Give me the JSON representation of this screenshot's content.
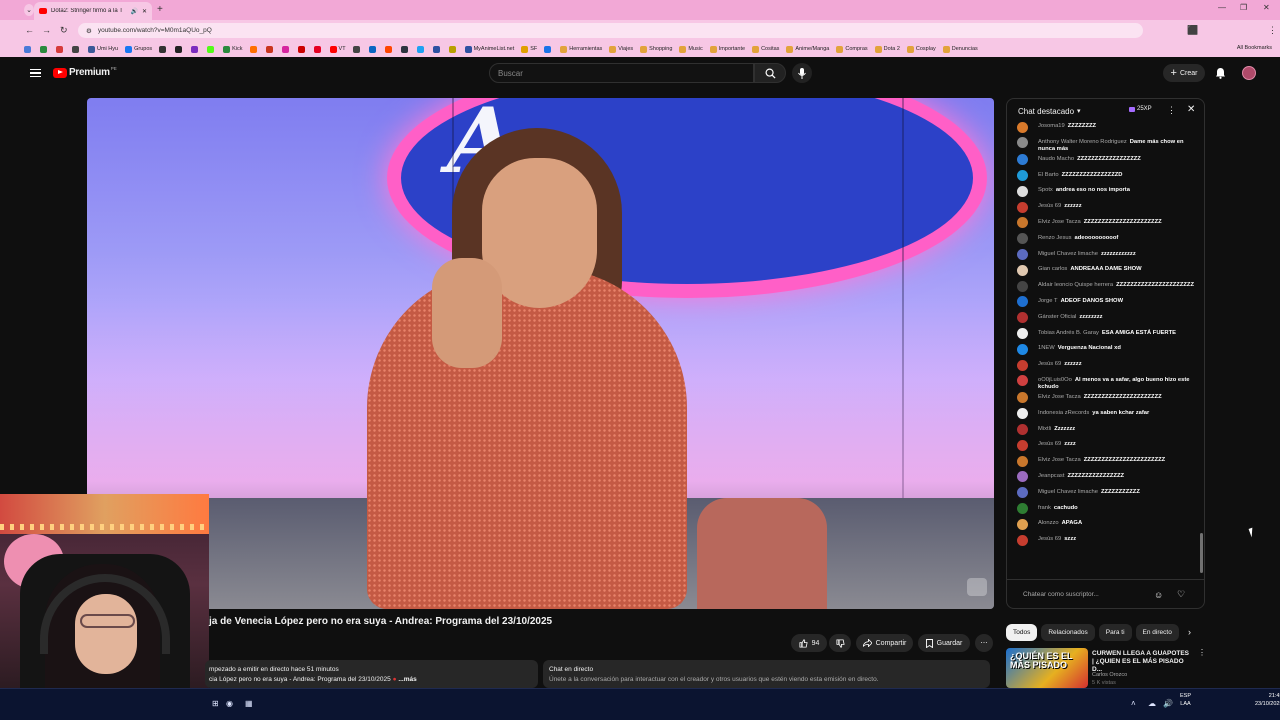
{
  "browser": {
    "tab_title": "Dota2: Stringer firmó a la T",
    "url": "youtube.com/watch?v=M0m1aQUo_pQ",
    "bookmarks": [
      "",
      "",
      "",
      "",
      "Umi Hyu",
      "Grupos",
      "",
      "",
      "",
      "",
      "Kick",
      "",
      "",
      "",
      "",
      "",
      "VT",
      "",
      "",
      "",
      "",
      "",
      "",
      "",
      "MyAnimeList.net",
      "SF",
      "",
      "Herramientas",
      "Viajes",
      "Shopping",
      "Music",
      "Importante",
      "Cositas",
      "Anime/Manga",
      "Compras",
      "Dota 2",
      "Cosplay",
      "Denuncias"
    ],
    "all_bookmarks": "All Bookmarks"
  },
  "youtube": {
    "logo_text": "Premium",
    "region": "PE",
    "search_placeholder": "Buscar",
    "create_label": "Crear"
  },
  "video": {
    "title": "ja de Venecia López pero no era suya - Andrea: Programa del 23/10/2025",
    "like_count": "94",
    "share_label": "Compartir",
    "save_label": "Guardar",
    "desc_line1": "mpezado a emitir en directo hace 51 minutos",
    "desc_line2": "cia López pero no era suya - Andrea: Programa del 23/10/2025",
    "desc_more": "...más",
    "livechat_title": "Chat en directo",
    "livechat_text": "Únete a la conversación para interactuar con el creador y otros usuarios que estén viendo esta emisión en directo."
  },
  "chat": {
    "header": "Chat destacado",
    "xp": "25XP",
    "input_placeholder": "Chatear como suscriptor...",
    "messages": [
      {
        "name": "Josoma19",
        "text": "ZZZZZZZZ",
        "color": "#d97a2b"
      },
      {
        "name": "Anthony Walter Moreno Rodriguez",
        "text": "Dame más chow en nunca más",
        "color": "#8a8a8a"
      },
      {
        "name": "Naudo Macho",
        "text": "ZZZZZZZZZZZZZZZZZZ",
        "color": "#2d7bd4"
      },
      {
        "name": "El Barto",
        "text": "ZZZZZZZZZZZZZZZZD",
        "color": "#1f9bd8"
      },
      {
        "name": "Spotx",
        "text": "andrea eso no nos importa",
        "color": "#dddddd"
      },
      {
        "name": "Jesús 69",
        "text": "zzzzzz",
        "color": "#c63d2f"
      },
      {
        "name": "Elviz Jose Tacza",
        "text": "ZZZZZZZZZZZZZZZZZZZZZZ",
        "color": "#c9772c"
      },
      {
        "name": "Renzo Jesus",
        "text": "adeooooooooof",
        "color": "#555555"
      },
      {
        "name": "Miguel Chavez limache",
        "text": "zzzzzzzzzzzz",
        "color": "#5c6bc0"
      },
      {
        "name": "Gian carlos",
        "text": "ANDREAAA DAME SHOW",
        "color": "#e0c8b0"
      },
      {
        "name": "Aldair leoncio Quispe herrera",
        "text": "ZZZZZZZZZZZZZZZZZZZZZZ",
        "color": "#444444"
      },
      {
        "name": "Jorge T",
        "text": "ADEOF DANOS SHOW",
        "color": "#1e6fd0"
      },
      {
        "name": "Gánster Oficial",
        "text": "zzzzzzzz",
        "color": "#b03030"
      },
      {
        "name": "Tobias Andrés B. Garay",
        "text": "ESA AMIGA ESTÁ FUERTE",
        "color": "#eeeeee"
      },
      {
        "name": "1NEW",
        "text": "Verguenza Nacional xd",
        "color": "#1e88e5"
      },
      {
        "name": "Jesús 69",
        "text": "zzzzzz",
        "color": "#c63d2f"
      },
      {
        "name": "oO0jLuis0Oo",
        "text": "Al menos va a safar, algo bueno hizo este kchudo",
        "color": "#d04040"
      },
      {
        "name": "Elviz Jose Tacza",
        "text": "ZZZZZZZZZZZZZZZZZZZZZZ",
        "color": "#c9772c"
      },
      {
        "name": "Indonesia zRecords",
        "text": "ya saben kchar zafar",
        "color": "#eeeeee"
      },
      {
        "name": "Mixtli",
        "text": "Zzzzzzz",
        "color": "#b03030"
      },
      {
        "name": "Jesús 69",
        "text": "zzzz",
        "color": "#c63d2f"
      },
      {
        "name": "Elviz Jose Tacza",
        "text": "ZZZZZZZZZZZZZZZZZZZZZZZ",
        "color": "#c9772c"
      },
      {
        "name": "Jeanpcast",
        "text": "ZZZZZZZZZZZZZZZZ",
        "color": "#9b6bbf"
      },
      {
        "name": "Miguel Chavez limache",
        "text": "ZZZZZZZZZZZ",
        "color": "#5c6bc0"
      },
      {
        "name": "frank",
        "text": "cachudo",
        "color": "#2e7d32"
      },
      {
        "name": "Alonzzo",
        "text": "APAGA",
        "color": "#e0a050"
      },
      {
        "name": "Jesús 69",
        "text": "szzz",
        "color": "#c63d2f"
      }
    ]
  },
  "sidebar": {
    "chips": [
      "Todos",
      "Relacionados",
      "Para ti",
      "En directo"
    ],
    "rec_title": "CURWEN LLEGA A GUAPOTES | ¿QUIEN ES EL MÁS PISADO D...",
    "rec_channel": "Carlos Orozco",
    "rec_views": "5 K vistas",
    "rec_thumb_text": "¿QUIÉN ES EL MÁS PISADO"
  },
  "taskbar": {
    "lang": "ESP",
    "lang2": "LAA",
    "time": "21:45",
    "date": "23/10/2025"
  }
}
